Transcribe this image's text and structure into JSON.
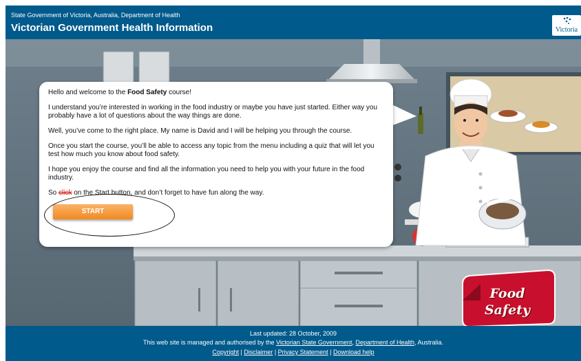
{
  "header": {
    "subtitle": "State Government of Victoria, Australia, Department of Health",
    "title": "Victorian Government Health Information",
    "logo_text": "Victoria"
  },
  "bubble": {
    "greeting_prefix": "Hello and welcome to the ",
    "greeting_bold": "Food Safety",
    "greeting_suffix": " course!",
    "p2": "I understand you’re interested in working in the food industry or maybe you have just started. Either way you probably have a lot of questions about the way things are done.",
    "p3": "Well, you’ve come to the right place. My name is David and I will be helping you through the course.",
    "p4": "Once you start the course, you’ll be able to access any topic from the menu including a quiz that will let you test how much you know about food safety.",
    "p5": "I hope you enjoy the course and find all the information you need to help you with your future in the food industry.",
    "p6_prefix": "So ",
    "p6_strike": "click",
    "p6_suffix": " on the Start button, and don’t forget to have fun along the way.",
    "start_label": "START"
  },
  "badge": {
    "line1": "Food",
    "line2": "Safety"
  },
  "footer": {
    "updated": "Last updated: 28 October, 2009",
    "managed_prefix": "This web site is managed and authorised by the ",
    "link_gov": "Victorian State Government",
    "sep": ", ",
    "link_doh": "Department of Health",
    "managed_suffix": ", Australia.",
    "links": [
      "Copyright",
      "Disclaimer",
      "Privacy Statement",
      "Download help"
    ],
    "link_sep": " | "
  },
  "colors": {
    "header_bg": "#005a8c",
    "button": "#f18a1f",
    "badge": "#c8102e"
  },
  "icons": [
    "victoria-logo-icon",
    "chef-illustration",
    "kitchen-background"
  ]
}
